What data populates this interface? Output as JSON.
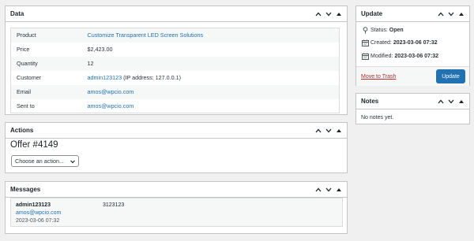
{
  "data_box": {
    "title": "Data",
    "rows": [
      {
        "label": "Product",
        "value": "Customize Transparent LED Screen Solutions",
        "link": true
      },
      {
        "label": "Price",
        "value": "$2,423.00"
      },
      {
        "label": "Quantity",
        "value": "12"
      },
      {
        "label": "Customer",
        "link_text": "admin123123",
        "suffix": "(IP address: 127.0.0.1)"
      },
      {
        "label": "Email",
        "value": "amos@wpcio.com",
        "link": true
      },
      {
        "label": "Sent to",
        "value": "amos@wpcio.com",
        "link": true
      }
    ]
  },
  "actions_box": {
    "title": "Actions",
    "offer_title": "Offer #4149",
    "select_value": "Choose an action..."
  },
  "messages_box": {
    "title": "Messages",
    "message": {
      "author": "admin123123",
      "email": "amos@wpcio.com",
      "date": "2023-03-06 07:32",
      "body": "3123123"
    }
  },
  "update_box": {
    "title": "Update",
    "status_label": "Status:",
    "status_value": "Open",
    "created_label": "Created:",
    "created_value": "2023-03-06 07:32",
    "modified_label": "Modified:",
    "modified_value": "2023-03-06 07:32",
    "trash_label": "Move to Trash",
    "update_label": "Update"
  },
  "notes_box": {
    "title": "Notes",
    "empty_text": "No notes yet."
  },
  "icons": {
    "move_up": "chevron-up-icon",
    "move_down": "chevron-down-icon",
    "toggle": "triangle-up-icon",
    "status": "pin-icon",
    "calendar": "calendar-icon"
  },
  "colors": {
    "accent": "#2271b1",
    "trash": "#b32d2e",
    "background": "#f0f0f1"
  }
}
